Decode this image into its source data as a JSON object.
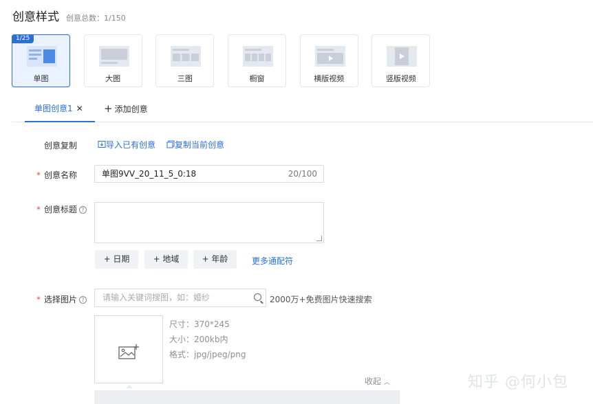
{
  "header": {
    "title": "创意样式",
    "count": "创意总数：1/150"
  },
  "styles": [
    {
      "label": "单图",
      "badge": "1/25",
      "active": true
    },
    {
      "label": "大图"
    },
    {
      "label": "三图"
    },
    {
      "label": "橱窗"
    },
    {
      "label": "横版视频"
    },
    {
      "label": "竖版视频"
    }
  ],
  "tabs": {
    "active": "单图创意1",
    "close": "✕",
    "add": "添加创意"
  },
  "copy": {
    "label": "创意复制",
    "import": "导入已有创意",
    "duplicate": "复制当前创意"
  },
  "name": {
    "label": "创意名称",
    "value": "单图9VV_20_11_5_0:18",
    "counter": "20/100"
  },
  "title_field": {
    "label": "创意标题"
  },
  "wildcards": {
    "items": [
      "+ 日期",
      "+ 地域",
      "+ 年龄"
    ],
    "more": "更多通配符"
  },
  "image": {
    "label": "选择图片",
    "search_placeholder": "请输入关键词搜图，如：婚纱",
    "search_hint": "2000万+免费图片快速搜索",
    "spec_size": "尺寸：370*245",
    "spec_weight": "大小：200kb内",
    "spec_format": "格式：jpg/jpeg/png",
    "collapse": "收起"
  },
  "watermark": "知乎 @何小包",
  "colors": {
    "accent": "#2c6fd6",
    "required": "#e34d4d"
  }
}
